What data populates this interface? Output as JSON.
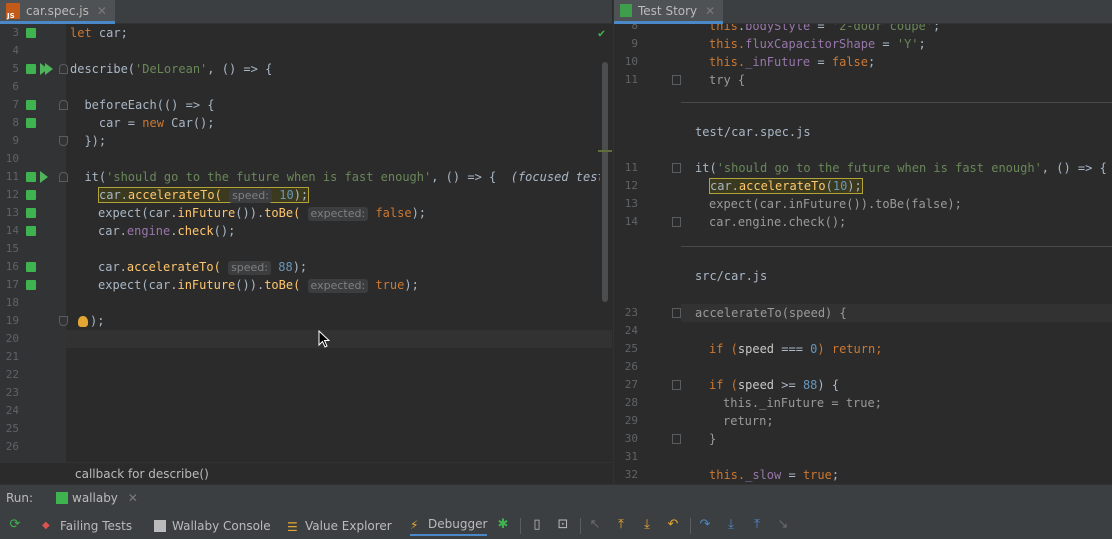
{
  "left_editor": {
    "tab": {
      "label": "car.spec.js",
      "close": "✕"
    },
    "gutter_lines": [
      {
        "n": "3",
        "cov": true
      },
      {
        "n": "4",
        "cov": false
      },
      {
        "n": "5",
        "cov": true,
        "run": "double",
        "fold": "start"
      },
      {
        "n": "6",
        "cov": false
      },
      {
        "n": "7",
        "cov": true,
        "fold": "start"
      },
      {
        "n": "8",
        "cov": true
      },
      {
        "n": "9",
        "cov": false,
        "fold": "end"
      },
      {
        "n": "10",
        "cov": false
      },
      {
        "n": "11",
        "cov": true,
        "run": "single",
        "fold": "start"
      },
      {
        "n": "12",
        "cov": true
      },
      {
        "n": "13",
        "cov": true
      },
      {
        "n": "14",
        "cov": true
      },
      {
        "n": "15",
        "cov": false
      },
      {
        "n": "16",
        "cov": true
      },
      {
        "n": "17",
        "cov": true
      },
      {
        "n": "18",
        "cov": false
      },
      {
        "n": "19",
        "cov": false,
        "fold": "end"
      },
      {
        "n": "20",
        "cov": false
      },
      {
        "n": "21",
        "cov": false
      },
      {
        "n": "22",
        "cov": false
      },
      {
        "n": "23",
        "cov": false
      },
      {
        "n": "24",
        "cov": false
      },
      {
        "n": "25",
        "cov": false
      },
      {
        "n": "26",
        "cov": false
      }
    ],
    "code": {
      "l3_kw": "let",
      "l3_rest": " car;",
      "l5_a": "describe(",
      "l5_str": "'DeLorean'",
      "l5_b": ", () => {",
      "l7_a": "  beforeEach(() => {",
      "l8_a": "    car = ",
      "l8_kw": "new",
      "l8_b": " Car();",
      "l9_a": "  });",
      "l11_a": "  it(",
      "l11_str": "'should go to the future when is fast enough'",
      "l11_b": ", () => {",
      "l11_note": "(focused test)",
      "l12_a": "car.",
      "l12_fn": "accelerateTo(",
      "l12_hint": "speed:",
      "l12_num": "10",
      "l12_b": ");",
      "l13_a": "expect(car.",
      "l13_fn": "inFuture",
      "l13_b": "()).",
      "l13_fn2": "toBe(",
      "l13_hint": "expected:",
      "l13_kw": "false",
      "l13_c": ");",
      "l14_a": "car.",
      "l14_b": "engine",
      "l14_c": ".",
      "l14_fn": "check",
      "l14_d": "();",
      "l16_a": "car.",
      "l16_fn": "accelerateTo(",
      "l16_hint": "speed:",
      "l16_num": "88",
      "l16_b": ");",
      "l17_a": "expect(car.",
      "l17_fn": "inFuture",
      "l17_b": "()).",
      "l17_fn2": "toBe(",
      "l17_hint": "expected:",
      "l17_kw": "true",
      "l17_c": ");",
      "l19_a": ");"
    },
    "breadcrumb": "callback for describe()"
  },
  "right_pane": {
    "tab": {
      "label": "Test Story",
      "close": "✕"
    },
    "top_lines": [
      {
        "n": "8",
        "code": "this.bodyStyle = '2-door coupe';"
      },
      {
        "n": "9",
        "a": "this.",
        "b": "fluxCapacitorShape",
        "c": " = ",
        "str": "'Y'",
        "d": ";"
      },
      {
        "n": "10",
        "a": "this.",
        "b": "_inFuture",
        "c": " = ",
        "kw": "false",
        "d": ";"
      },
      {
        "n": "11",
        "code": "try {"
      }
    ],
    "section1_title": "test/car.spec.js",
    "section1_lines": [
      {
        "n": "11",
        "a": "it(",
        "str": "'should go to the future when is fast enough'",
        "b": ", () => {"
      },
      {
        "n": "12",
        "a": "car.",
        "fn": "accelerateTo",
        "b": "(",
        "num": "10",
        "c": ");"
      },
      {
        "n": "13",
        "code": "expect(car.inFuture()).toBe(false);"
      },
      {
        "n": "14",
        "code": "car.engine.check();"
      }
    ],
    "section2_title": "src/car.js",
    "section2_lines": [
      {
        "n": "23",
        "code": "accelerateTo(speed) {"
      },
      {
        "n": "24",
        "code": ""
      },
      {
        "n": "25",
        "a": "if (",
        "b": "speed",
        "c": " === ",
        "num": "0",
        "d": ") return;"
      },
      {
        "n": "26",
        "code": ""
      },
      {
        "n": "27",
        "a": "if (",
        "b": "speed",
        "c": " >= ",
        "num": "88",
        "d": ") {"
      },
      {
        "n": "28",
        "code": "this._inFuture = true;"
      },
      {
        "n": "29",
        "code": "return;"
      },
      {
        "n": "30",
        "code": "}"
      },
      {
        "n": "31",
        "code": ""
      },
      {
        "n": "32",
        "a": "this.",
        "b": "_slow",
        "c": " = ",
        "kw": "true",
        "d": ";"
      }
    ]
  },
  "run_window": {
    "label": "Run:",
    "tab": "wallaby",
    "tab_close": "✕"
  },
  "toolbar": {
    "failing_tests": "Failing Tests",
    "wallaby_console": "Wallaby Console",
    "value_explorer": "Value Explorer",
    "debugger": "Debugger"
  },
  "colors": {
    "accent": "#4a88c7",
    "coverage": "#3fb34f",
    "keyword": "#cc7832",
    "string": "#6a8759",
    "number": "#6897bb"
  }
}
